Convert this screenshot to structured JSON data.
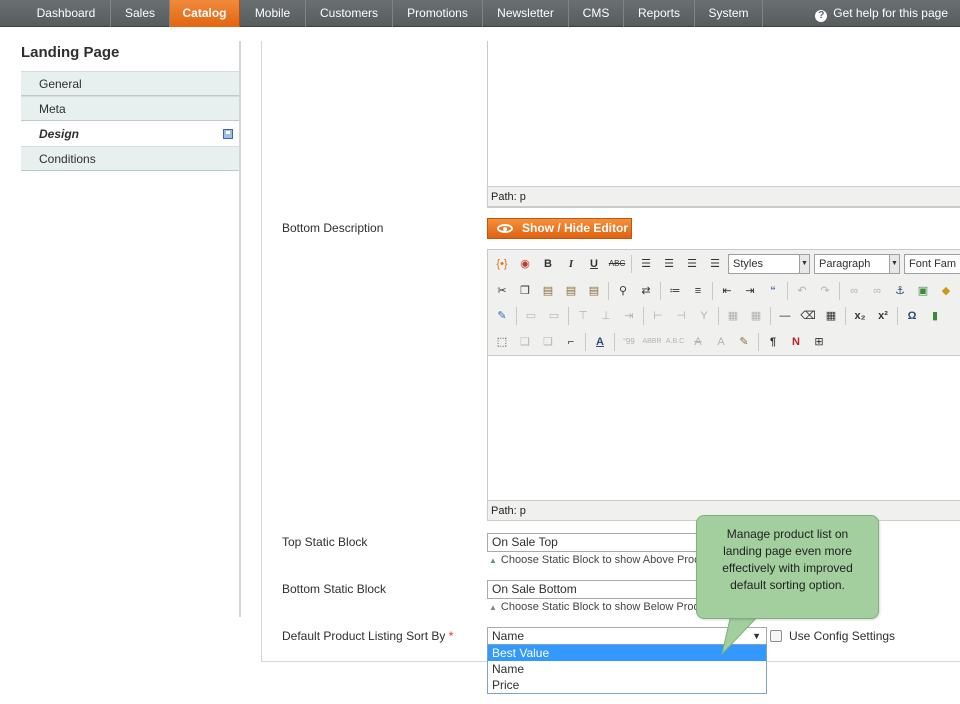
{
  "nav": {
    "items": [
      "Dashboard",
      "Sales",
      "Catalog",
      "Mobile",
      "Customers",
      "Promotions",
      "Newsletter",
      "CMS",
      "Reports",
      "System"
    ],
    "active": "Catalog",
    "help": "Get help for this page"
  },
  "sidebar": {
    "title": "Landing Page",
    "tabs": [
      "General",
      "Meta",
      "Design",
      "Conditions"
    ],
    "active_tab": "Design"
  },
  "main": {
    "path_label_top": "Path: p",
    "bottom_description_label": "Bottom Description",
    "toggle_editor": "Show / Hide Editor",
    "editor": {
      "styles": "Styles",
      "format": "Paragraph",
      "font": "Font Fam",
      "path_label": "Path: p"
    },
    "top_static_block": {
      "label": "Top Static Block",
      "value": "On Sale Top",
      "note": "Choose Static Block to show Above Proc"
    },
    "bottom_static_block": {
      "label": "Bottom Static Block",
      "value": "On Sale Bottom",
      "note": "Choose Static Block to show Below Prod"
    },
    "sort_by": {
      "label": "Default Product Listing Sort By",
      "required": "*",
      "value": "Name",
      "options": [
        "Best Value",
        "Name",
        "Price"
      ],
      "highlighted": "Best Value",
      "use_config": "Use Config Settings"
    }
  },
  "callout": {
    "text": "Manage product list on landing page even more effectively with improved default sorting option."
  },
  "colors": {
    "accent": "#e8731e",
    "nav_bg": "#5f6467",
    "tab_bg": "#e7efef",
    "callout_bg": "#a3cf9f",
    "option_highlight": "#3399ff"
  }
}
